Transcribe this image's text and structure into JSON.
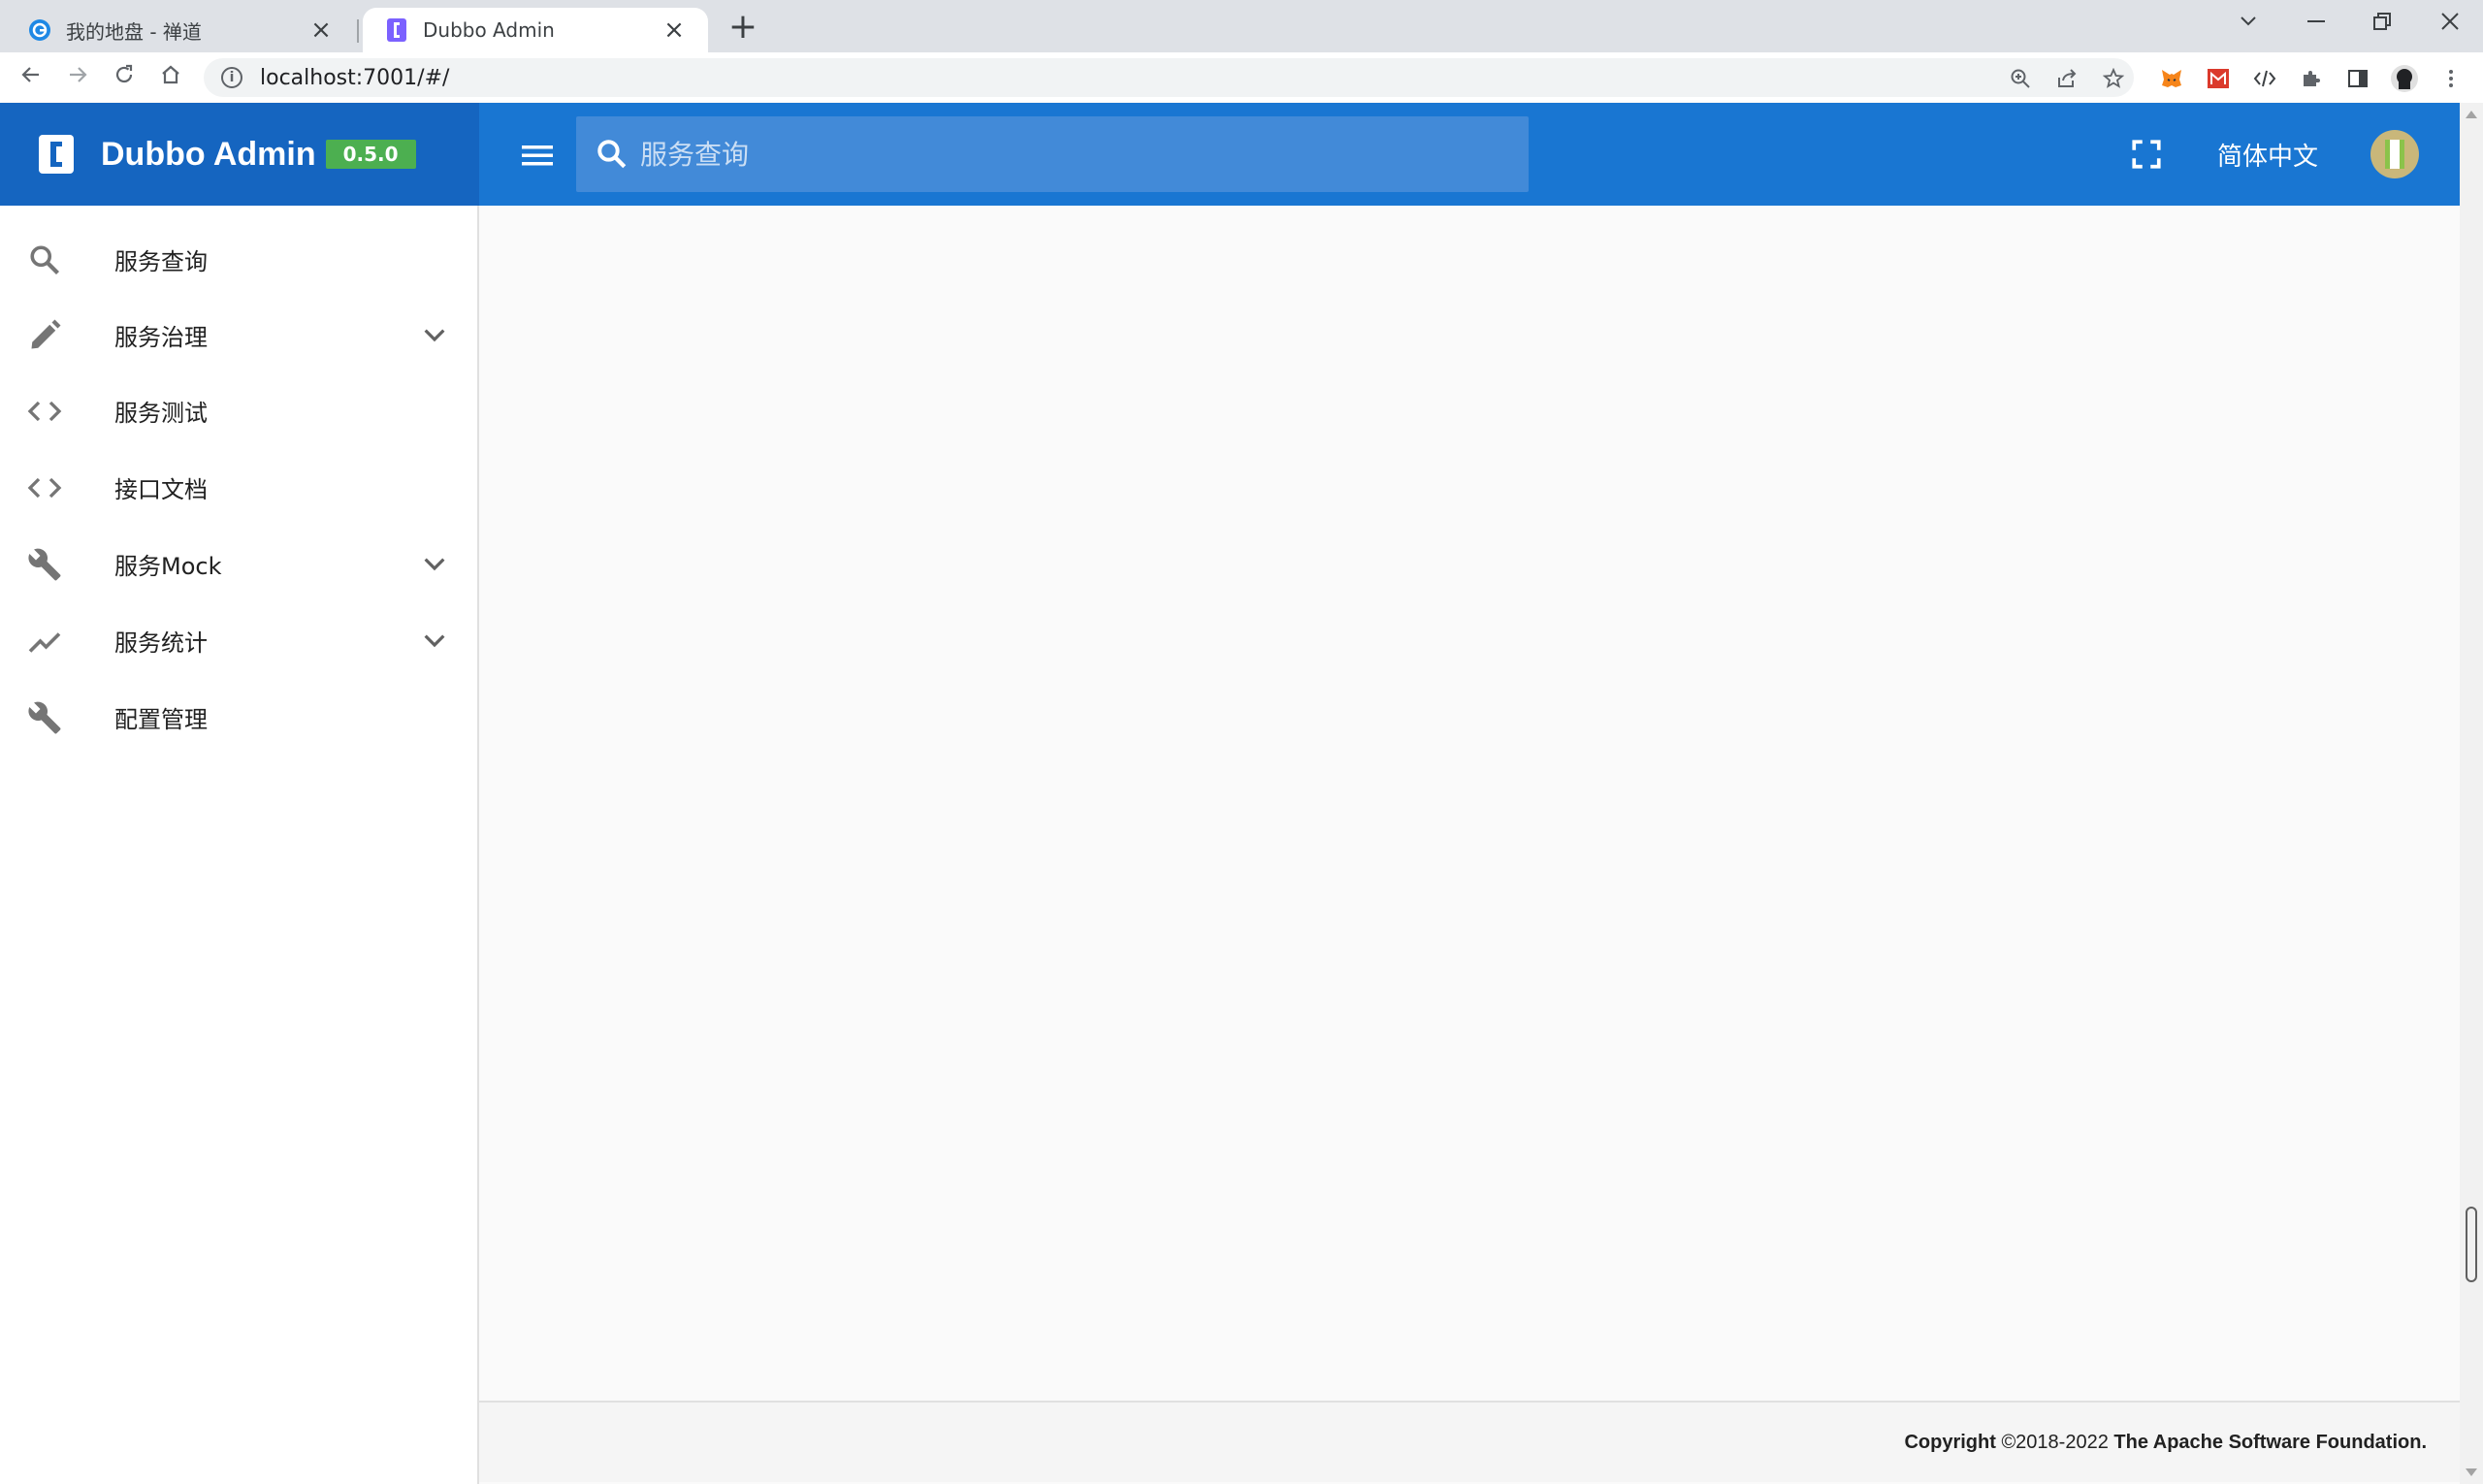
{
  "browser": {
    "tabs": [
      {
        "title": "我的地盘 - 禅道",
        "active": false
      },
      {
        "title": "Dubbo Admin",
        "active": true
      }
    ],
    "url": "localhost:7001/#/"
  },
  "header": {
    "brand": "Dubbo Admin",
    "version": "0.5.0",
    "search_placeholder": "服务查询",
    "language": "简体中文"
  },
  "sidebar": {
    "items": [
      {
        "label": "服务查询",
        "icon": "search-icon",
        "expandable": false
      },
      {
        "label": "服务治理",
        "icon": "pencil-icon",
        "expandable": true
      },
      {
        "label": "服务测试",
        "icon": "code-icon",
        "expandable": false
      },
      {
        "label": "接口文档",
        "icon": "code-icon",
        "expandable": false
      },
      {
        "label": "服务Mock",
        "icon": "wrench-icon",
        "expandable": true
      },
      {
        "label": "服务统计",
        "icon": "trending-icon",
        "expandable": true
      },
      {
        "label": "配置管理",
        "icon": "wrench-icon",
        "expandable": false
      }
    ]
  },
  "footer": {
    "copyright_label": "Copyright",
    "years": "©2018-2022",
    "org": "The Apache Software Foundation."
  },
  "colors": {
    "header": "#1976d2",
    "brand_bg": "#1565c0",
    "version_chip": "#4caf50"
  }
}
